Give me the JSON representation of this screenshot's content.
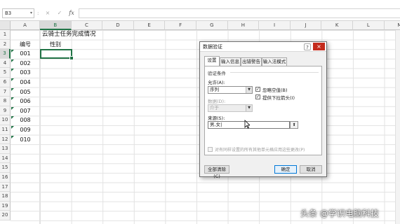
{
  "formula_bar": {
    "name_box": "B3",
    "name_box_icon": "chevron-down-icon",
    "separator": ":",
    "cancel_icon": "×",
    "confirm_icon": "✓",
    "fx": "fx",
    "content": ""
  },
  "columns": [
    "A",
    "B",
    "C",
    "D",
    "E",
    "F",
    "G",
    "H",
    "I",
    "J",
    "K",
    "L",
    "M"
  ],
  "rows": [
    "1",
    "2",
    "3",
    "4",
    "5",
    "6",
    "7",
    "8",
    "9",
    "10",
    "11",
    "12",
    "13",
    "14",
    "15",
    "16",
    "17",
    "18",
    "19",
    "20"
  ],
  "sheet": {
    "title": "云骑士任务完成情况",
    "header_a": "编号",
    "header_b": "性别",
    "ids": [
      "001",
      "002",
      "003",
      "004",
      "005",
      "006",
      "007",
      "008",
      "009",
      "010"
    ],
    "active_cell": "B3"
  },
  "dialog": {
    "title": "数据验证",
    "help": "?",
    "close": "×",
    "tabs": [
      "设置",
      "输入信息",
      "出错警告",
      "输入法模式"
    ],
    "active_tab": "设置",
    "group_label": "验证条件",
    "allow_label": "允许(A):",
    "allow_value": "序列",
    "ignore_blank_label": "忽略空值(B)",
    "ignore_blank_checked": true,
    "dropdown_label": "提供下拉箭头(I)",
    "dropdown_checked": true,
    "data_label": "数据(D):",
    "data_value": "介于",
    "source_label": "来源(S):",
    "source_value": "男,女|",
    "apply_all_label": "对有同样设置的所有其他单元格应用这些更改(P)",
    "apply_all_checked": false,
    "clear_all": "全部清除(C)",
    "ok": "确定",
    "cancel": "取消"
  },
  "watermark": "头条 @学识电脑科技"
}
